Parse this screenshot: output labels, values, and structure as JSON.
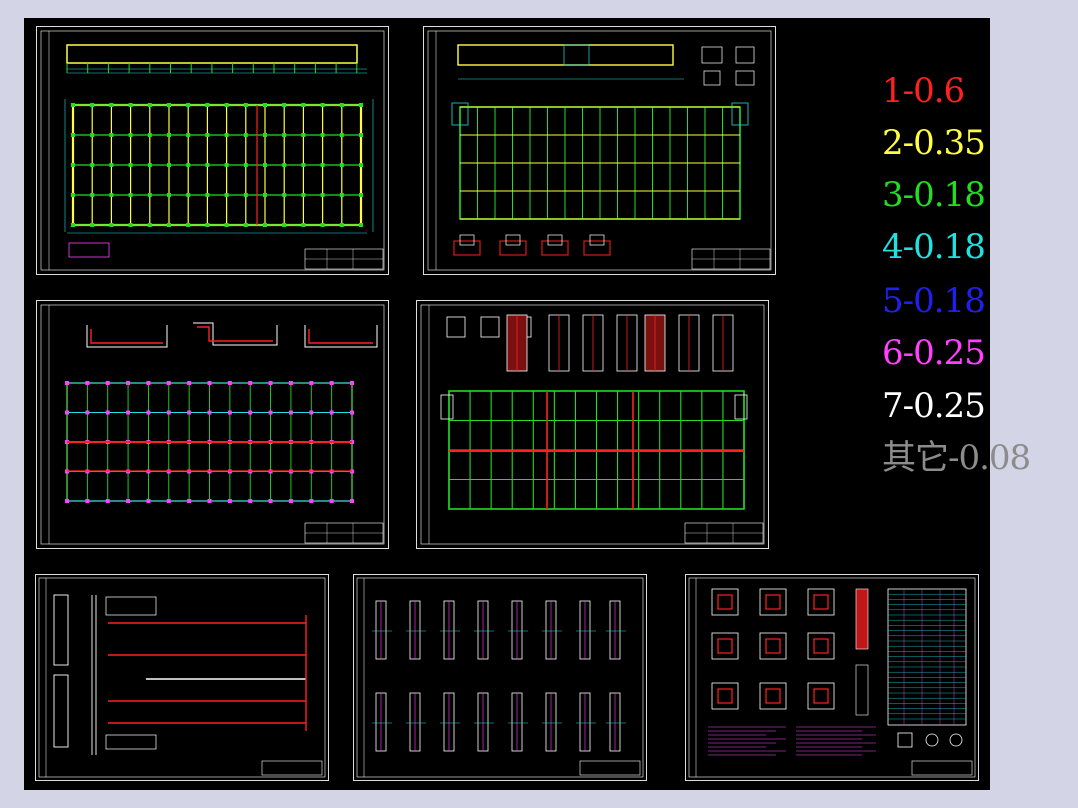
{
  "app": {
    "background": "#000000",
    "workspace_color": "#d3d5e6"
  },
  "legend": [
    {
      "label": "1-0.6",
      "color": "#ff2020"
    },
    {
      "label": "2-0.35",
      "color": "#ffff40"
    },
    {
      "label": "3-0.18",
      "color": "#22dd22"
    },
    {
      "label": "4-0.18",
      "color": "#22e0e0"
    },
    {
      "label": "5-0.18",
      "color": "#2020ee"
    },
    {
      "label": "6-0.25",
      "color": "#ff40ff"
    },
    {
      "label": "7-0.25",
      "color": "#ffffff"
    },
    {
      "label": "其它-0.08",
      "color": "#8c8c8c"
    }
  ],
  "sheets": [
    {
      "id": "sheet-1",
      "kind": "plan-yellow"
    },
    {
      "id": "sheet-2",
      "kind": "plan-green"
    },
    {
      "id": "sheet-3",
      "kind": "plan-red-green"
    },
    {
      "id": "sheet-4",
      "kind": "plan-details"
    },
    {
      "id": "sheet-5",
      "kind": "pipe-layout"
    },
    {
      "id": "sheet-6",
      "kind": "section-details"
    },
    {
      "id": "sheet-7",
      "kind": "column-details-table"
    }
  ]
}
